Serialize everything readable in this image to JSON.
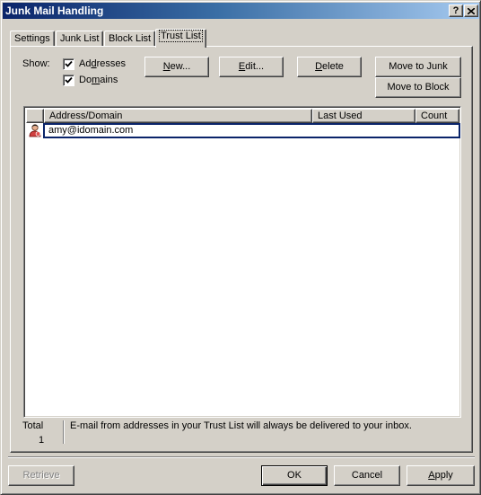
{
  "window": {
    "title": "Junk Mail Handling",
    "help_button": "?",
    "close_button": "✕"
  },
  "tabs": [
    {
      "label": "Settings",
      "active": false
    },
    {
      "label": "Junk List",
      "active": false
    },
    {
      "label": "Block List",
      "active": false
    },
    {
      "label": "Trust List",
      "active": true
    }
  ],
  "show": {
    "label": "Show:",
    "options": [
      {
        "label_pre": "Ad",
        "label_ul": "d",
        "label_post": "resses",
        "checked": true
      },
      {
        "label_pre": "Do",
        "label_ul": "m",
        "label_post": "ains",
        "checked": true
      }
    ]
  },
  "actions": {
    "new": {
      "ul": "N",
      "rest": "ew..."
    },
    "edit": {
      "ul": "E",
      "rest": "dit..."
    },
    "delete": {
      "ul": "D",
      "rest": "elete"
    },
    "move_to_junk": "Move to Junk",
    "move_to_block": "Move to Block"
  },
  "list": {
    "columns": [
      "Address/Domain",
      "Last Used",
      "Count"
    ],
    "rows": [
      {
        "icon": "trusted-contact-icon",
        "address": "amy@idomain.com",
        "last_used": "",
        "count": "",
        "selected": true
      }
    ]
  },
  "footer": {
    "total_label": "Total",
    "total_value": "1",
    "info_text": "E-mail from addresses in your Trust List will always be delivered to your inbox."
  },
  "dialog_buttons": {
    "retrieve": "Retrieve",
    "ok": "OK",
    "cancel": "Cancel",
    "apply_ul": "A",
    "apply_rest": "pply"
  },
  "colors": {
    "title_start": "#0a246a",
    "title_end": "#a6caf0",
    "face": "#d4d0c8",
    "selection_border": "#0a246a"
  }
}
